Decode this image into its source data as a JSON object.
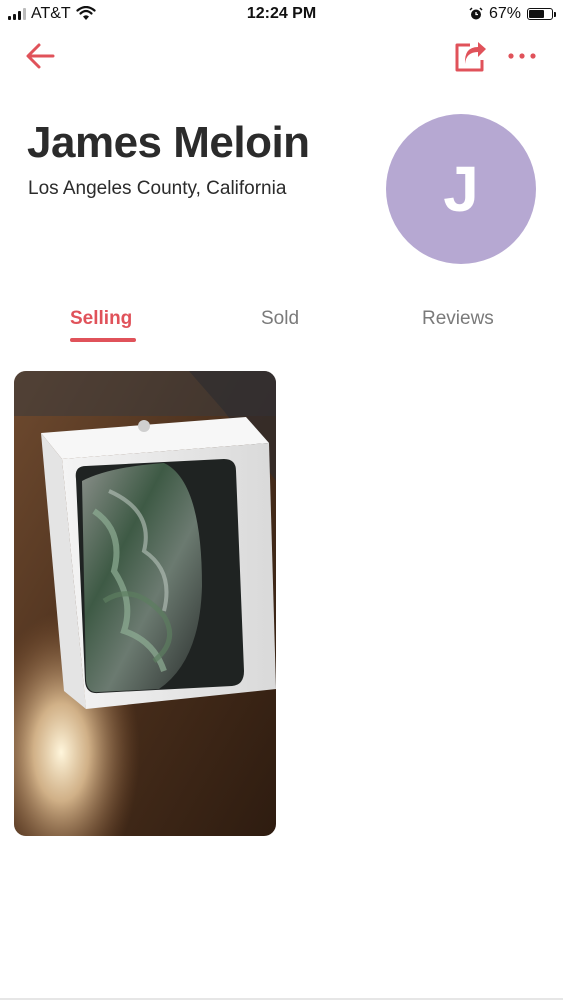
{
  "status_bar": {
    "carrier": "AT&T",
    "time": "12:24 PM",
    "battery": "67%",
    "battery_level": 0.67,
    "icons": [
      "signal-icon",
      "wifi-icon",
      "alarm-icon",
      "battery-icon"
    ]
  },
  "nav": {
    "icons": [
      "back-arrow-icon",
      "share-icon",
      "more-icon"
    ]
  },
  "profile": {
    "name": "James Meloin",
    "location": "Los Angeles County, California",
    "avatar_initial": "J"
  },
  "tabs": [
    {
      "label": "Selling",
      "active": true
    },
    {
      "label": "Sold",
      "active": false
    },
    {
      "label": "Reviews",
      "active": false
    }
  ],
  "listings": [
    {
      "image": "boxed-smartphone-photo"
    }
  ],
  "colors": {
    "accent": "#e0525a",
    "avatar": "#b6a8d2",
    "tab_inactive": "#7a7a7a",
    "text": "#2b2b2b"
  }
}
